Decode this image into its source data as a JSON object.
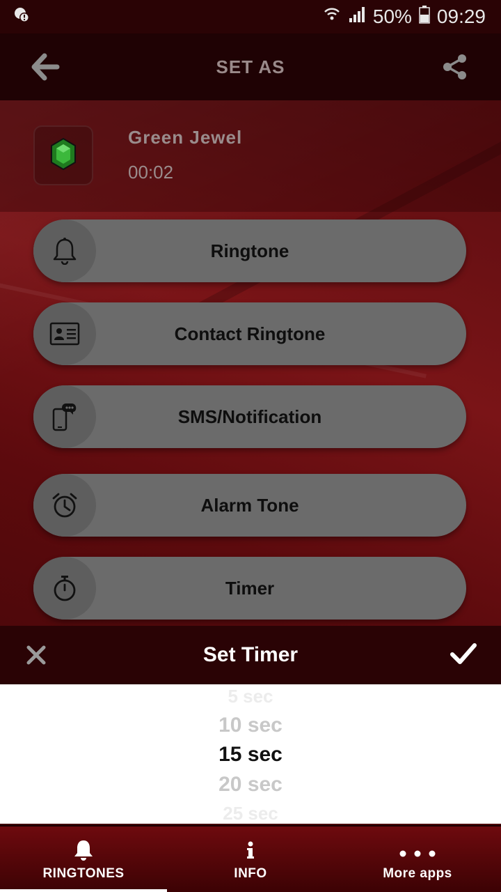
{
  "status_bar": {
    "battery": "50%",
    "time": "09:29"
  },
  "app_bar": {
    "title": "SET AS"
  },
  "song": {
    "title": "Green Jewel",
    "duration": "00:02"
  },
  "options": [
    {
      "label": "Ringtone",
      "icon": "bell-icon"
    },
    {
      "label": "Contact Ringtone",
      "icon": "contact-card-icon"
    },
    {
      "label": "SMS/Notification",
      "icon": "phone-message-icon"
    },
    {
      "label": "Alarm Tone",
      "icon": "alarm-clock-icon"
    },
    {
      "label": "Timer",
      "icon": "stopwatch-icon"
    }
  ],
  "dialog": {
    "title": "Set Timer",
    "picker_values": [
      "5 sec",
      "10 sec",
      "15 sec",
      "20 sec",
      "25 sec"
    ],
    "selected": "15 sec"
  },
  "bottom_nav": [
    {
      "label": "RINGTONES",
      "icon": "bell-icon",
      "active": true
    },
    {
      "label": "INFO",
      "icon": "info-icon",
      "active": false
    },
    {
      "label": "More apps",
      "icon": "more-dots-icon",
      "active": false
    }
  ],
  "colors": {
    "accent": "#6e0a0e",
    "option_bg": "#6b6b6b",
    "jewel": "#2a9a2a"
  }
}
